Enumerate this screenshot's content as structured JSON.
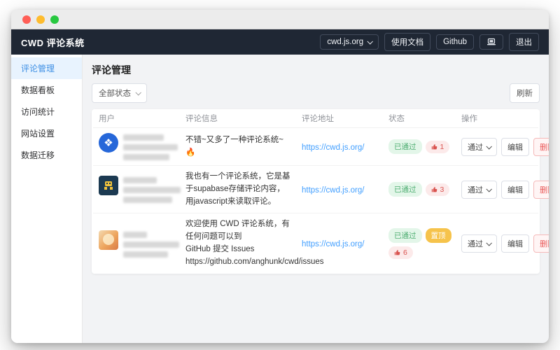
{
  "navbar": {
    "title": "CWD 评论系统",
    "site_select": "cwd.js.org",
    "docs_label": "使用文档",
    "github_label": "Github",
    "logout_label": "退出"
  },
  "sidebar": {
    "items": [
      {
        "label": "评论管理",
        "active": true
      },
      {
        "label": "数据看板",
        "active": false
      },
      {
        "label": "访问统计",
        "active": false
      },
      {
        "label": "网站设置",
        "active": false
      },
      {
        "label": "数据迁移",
        "active": false
      }
    ]
  },
  "main": {
    "page_title": "评论管理",
    "filter_select": "全部状态",
    "refresh_label": "刷新",
    "table": {
      "columns": [
        "用户",
        "评论信息",
        "评论地址",
        "状态",
        "操作"
      ],
      "rows": [
        {
          "comment": "不错~又多了一种评论系统~",
          "emoji": "🔥",
          "url": "https://cwd.js.org/",
          "status": "已通过",
          "likes": "1",
          "action_select": "通过",
          "edit_label": "编辑",
          "delete_label": "删除"
        },
        {
          "comment": "我也有一个评论系统，它是基于supabase存储评论内容，用javascript来读取评论。",
          "url": "https://cwd.js.org/",
          "status": "已通过",
          "likes": "3",
          "action_select": "通过",
          "edit_label": "编辑",
          "delete_label": "删除"
        },
        {
          "comment": "欢迎使用 CWD 评论系统，有任何问题可以到\nGitHub 提交 Issues\nhttps://github.com/anghunk/cwd/issues",
          "url": "https://cwd.js.org/",
          "status": "已通过",
          "pin": "置顶",
          "likes": "6",
          "action_select": "通过",
          "edit_label": "编辑",
          "delete_label": "删除"
        }
      ]
    }
  }
}
